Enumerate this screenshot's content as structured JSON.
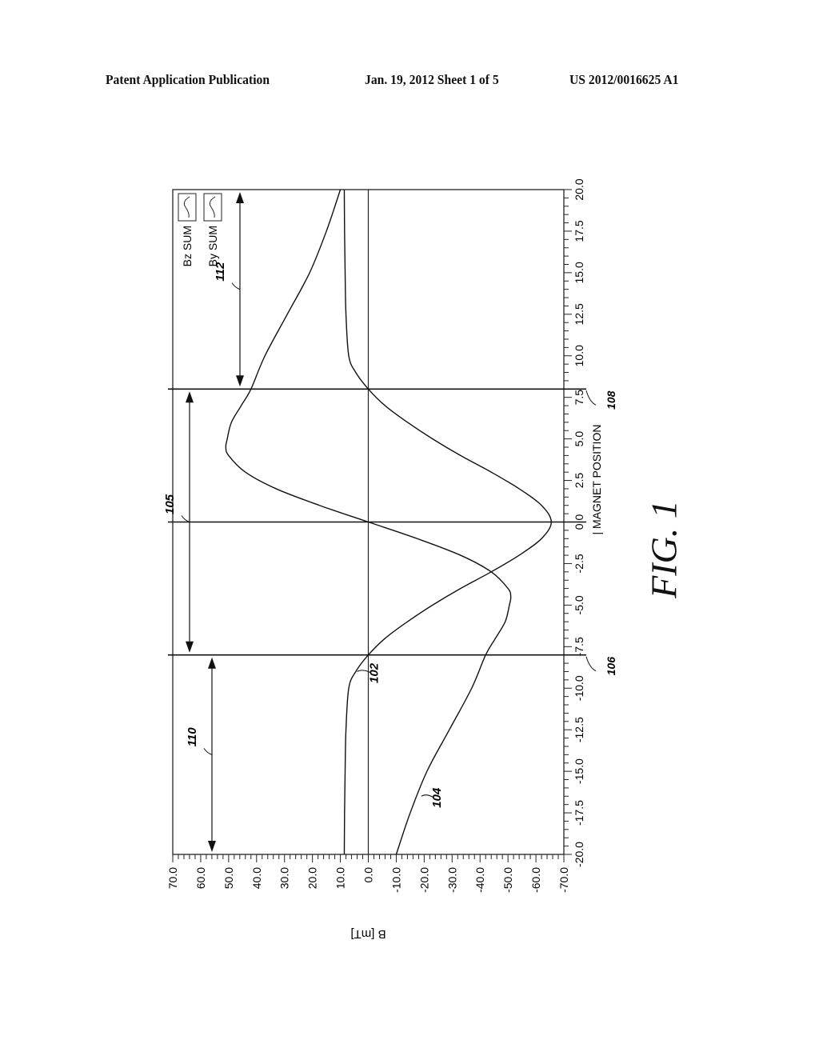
{
  "header": {
    "left": "Patent Application Publication",
    "middle": "Jan. 19, 2012  Sheet 1 of 5",
    "right": "US 2012/0016625 A1"
  },
  "figure_label": "FIG. 1",
  "chart_data": {
    "type": "line",
    "orientation": "rotated 90 degrees (x axis runs vertically on page)",
    "title": "",
    "xlabel": "MAGNET POSITION",
    "ylabel": "B [mT]",
    "xlim": [
      -20.0,
      20.0
    ],
    "ylim": [
      -70.0,
      70.0
    ],
    "x_ticks": [
      "-20.0",
      "-17.5",
      "-15.0",
      "-12.5",
      "-10.0",
      "-7.5",
      "-5.0",
      "-2.5",
      "0.0",
      "2.5",
      "5.0",
      "7.5",
      "10.0",
      "12.5",
      "15.0",
      "17.5",
      "20.0"
    ],
    "y_ticks": [
      "70.0",
      "60.0",
      "50.0",
      "40.0",
      "30.0",
      "20.0",
      "10.0",
      "0.0",
      "-10.0",
      "-20.0",
      "-30.0",
      "-40.0",
      "-50.0",
      "-60.0",
      "-70.0"
    ],
    "grid": false,
    "legend": {
      "placement": "top-left",
      "entries": [
        "Bz SUM",
        "By SUM"
      ]
    },
    "series": [
      {
        "name": "By SUM",
        "ref": "102",
        "x": [
          -20,
          -17.5,
          -15,
          -12.5,
          -10,
          -9,
          -8,
          -7,
          -6,
          -5,
          -4,
          -3,
          -2,
          -1,
          0,
          1,
          2,
          3,
          4,
          5,
          6,
          7,
          8,
          9,
          10,
          12.5,
          15,
          17.5,
          20
        ],
        "y": [
          8.6,
          8.5,
          8.3,
          8.0,
          7.0,
          4.5,
          0.0,
          -6.0,
          -14.0,
          -23.0,
          -33.0,
          -44.0,
          -54.0,
          -62.0,
          -65.5,
          -62.0,
          -54.0,
          -44.0,
          -33.0,
          -23.0,
          -14.0,
          -6.0,
          0.0,
          4.5,
          7.0,
          8.0,
          8.3,
          8.5,
          8.6
        ]
      },
      {
        "name": "Bz SUM",
        "ref": "104",
        "x": [
          -20,
          -17.5,
          -15,
          -12.5,
          -10,
          -8,
          -7,
          -6,
          -5,
          -4.5,
          -4,
          -3,
          -2,
          -1,
          0,
          1,
          2,
          3,
          4,
          4.5,
          5,
          6,
          7,
          8,
          10,
          12.5,
          15,
          17.5,
          20
        ],
        "y": [
          -10.0,
          -15.0,
          -21.0,
          -29.0,
          -37.0,
          -42.0,
          -45.5,
          -49.0,
          -50.5,
          -51.0,
          -50.0,
          -44.0,
          -33.0,
          -17.5,
          0.0,
          17.5,
          33.0,
          44.0,
          50.0,
          51.0,
          50.5,
          49.0,
          45.5,
          42.0,
          37.0,
          29.0,
          21.0,
          15.0,
          10.0
        ]
      }
    ],
    "vertical_markers": [
      {
        "x": -8.0,
        "ref": "106"
      },
      {
        "x": 0.0,
        "ref": ""
      },
      {
        "x": 8.0,
        "ref": "108"
      }
    ],
    "range_arrows": [
      {
        "ref": "110",
        "from": -20.0,
        "to": -8.0
      },
      {
        "ref": "105",
        "from": -8.0,
        "to": 8.0
      },
      {
        "ref": "112",
        "from": 8.0,
        "to": 20.0
      }
    ],
    "annotations": [
      "102",
      "104",
      "105",
      "106",
      "108",
      "110",
      "112"
    ]
  }
}
